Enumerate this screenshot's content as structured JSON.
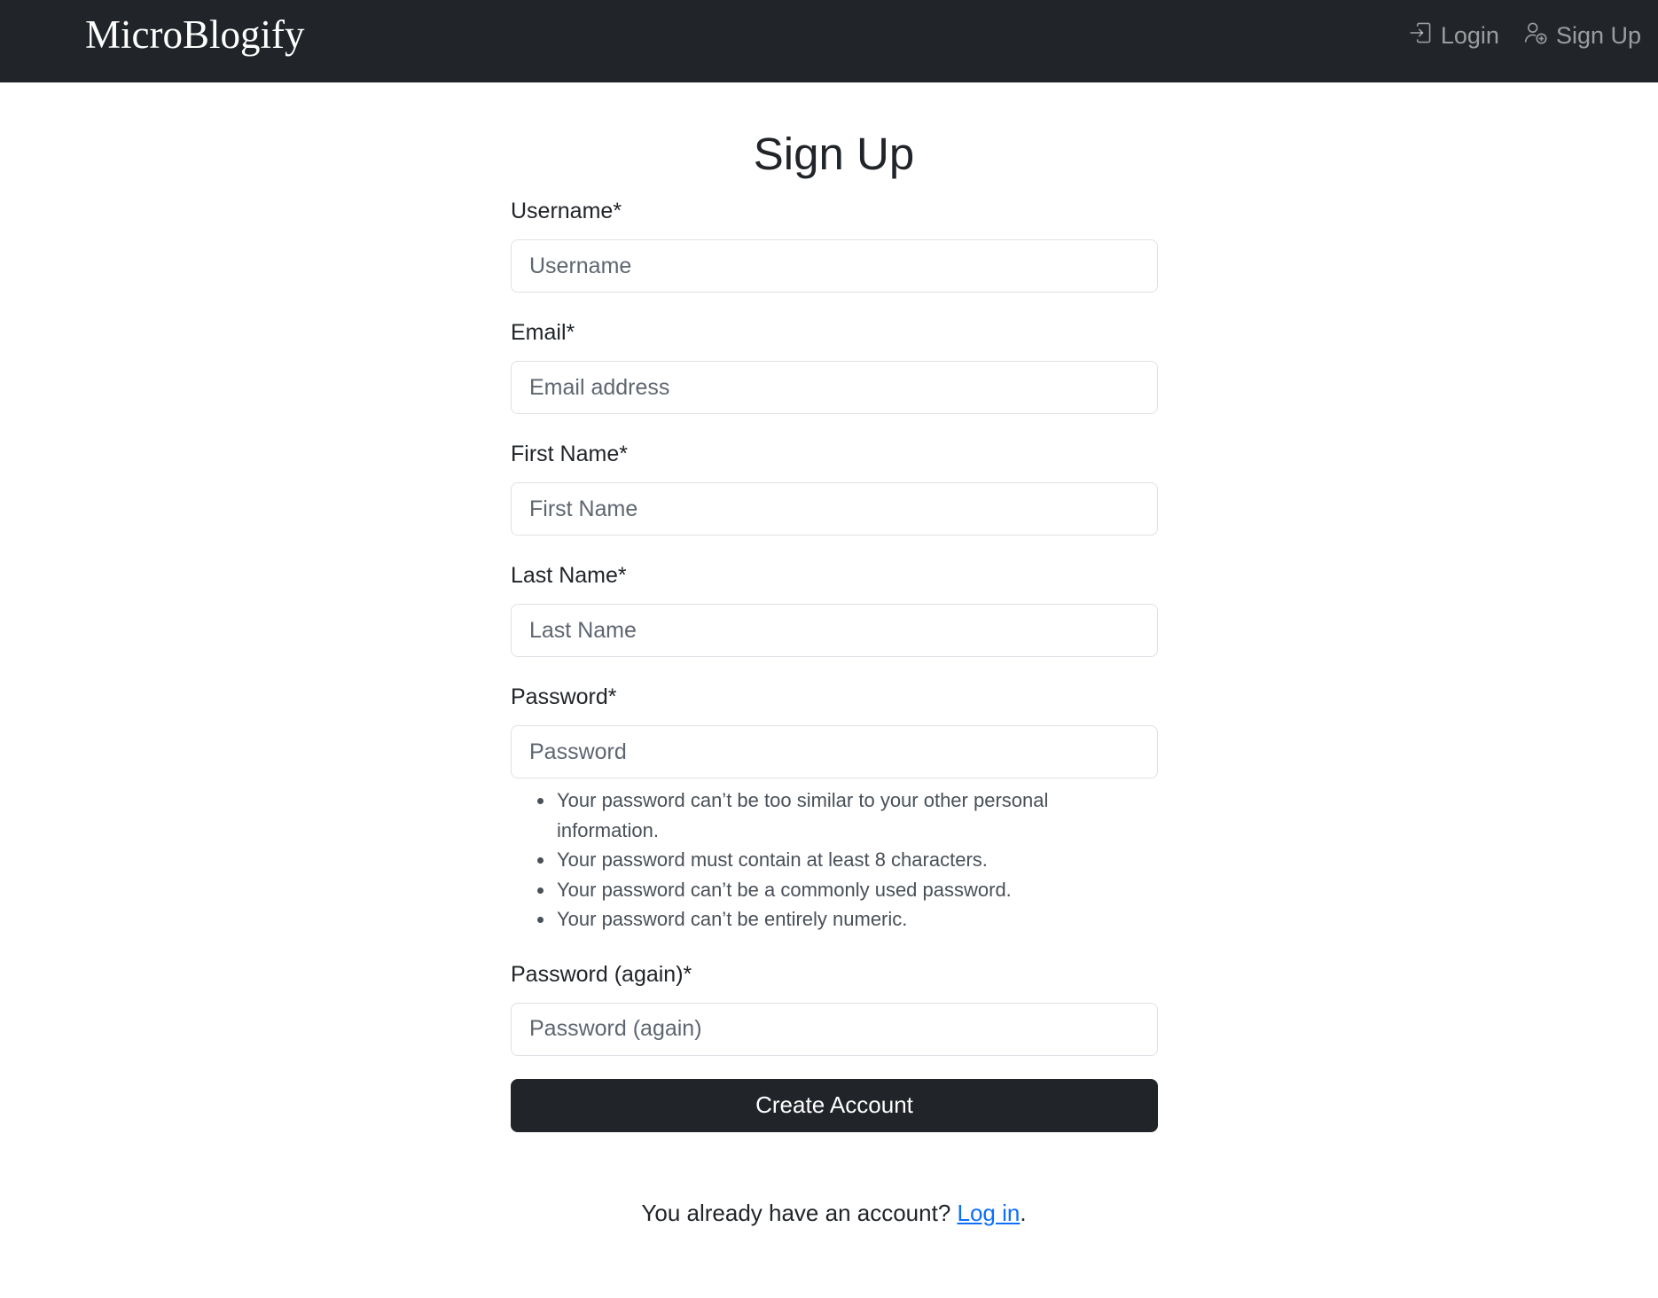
{
  "navbar": {
    "brand": "MicroBlogify",
    "login_label": "Login",
    "signup_label": "Sign Up",
    "background": "#212529"
  },
  "page": {
    "title": "Sign Up"
  },
  "form": {
    "username": {
      "label": "Username*",
      "placeholder": "Username",
      "value": ""
    },
    "email": {
      "label": "Email*",
      "placeholder": "Email address",
      "value": ""
    },
    "first_name": {
      "label": "First Name*",
      "placeholder": "First Name",
      "value": ""
    },
    "last_name": {
      "label": "Last Name*",
      "placeholder": "Last Name",
      "value": ""
    },
    "password": {
      "label": "Password*",
      "placeholder": "Password",
      "value": "",
      "help": [
        "Your password can’t be too similar to your other personal information.",
        "Your password must contain at least 8 characters.",
        "Your password can’t be a commonly used password.",
        "Your password can’t be entirely numeric."
      ]
    },
    "password_again": {
      "label": "Password (again)*",
      "placeholder": "Password (again)",
      "value": ""
    },
    "submit_label": "Create Account"
  },
  "footer": {
    "prefix": "You already have an account? ",
    "link_label": "Log in",
    "suffix": ".",
    "link_color": "#0d6efd"
  }
}
